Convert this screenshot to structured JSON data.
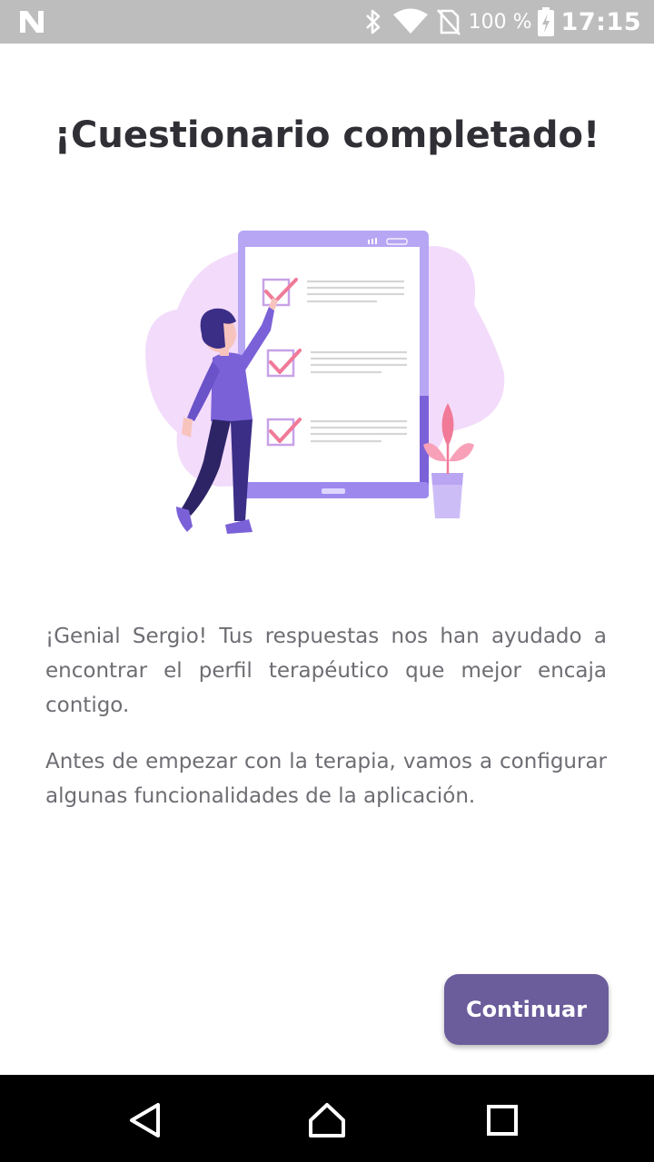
{
  "status_bar": {
    "battery_text": "100 %",
    "time": "17:15",
    "icons": [
      "n-logo-icon",
      "bluetooth-icon",
      "wifi-icon",
      "no-sim-icon",
      "battery-charging-icon"
    ]
  },
  "title": "¡Cuestionario completado!",
  "illustration": {
    "name": "person-checking-checklist",
    "colors": {
      "primary": "#7b61d8",
      "light": "#f1d8fb",
      "accent": "#f07a98",
      "dark": "#2d2466"
    }
  },
  "paragraphs": [
    "¡Genial Sergio! Tus respuestas nos han ayudado a encontrar el perfil terapéutico que mejor encaja contigo.",
    "Antes de empezar con la terapia, vamos a configurar algunas funcionalidades de la aplicación."
  ],
  "button": {
    "label": "Continuar",
    "color": "#6b5c9b"
  },
  "nav_bar": {
    "icons": [
      "back-icon",
      "home-icon",
      "recents-icon"
    ]
  }
}
